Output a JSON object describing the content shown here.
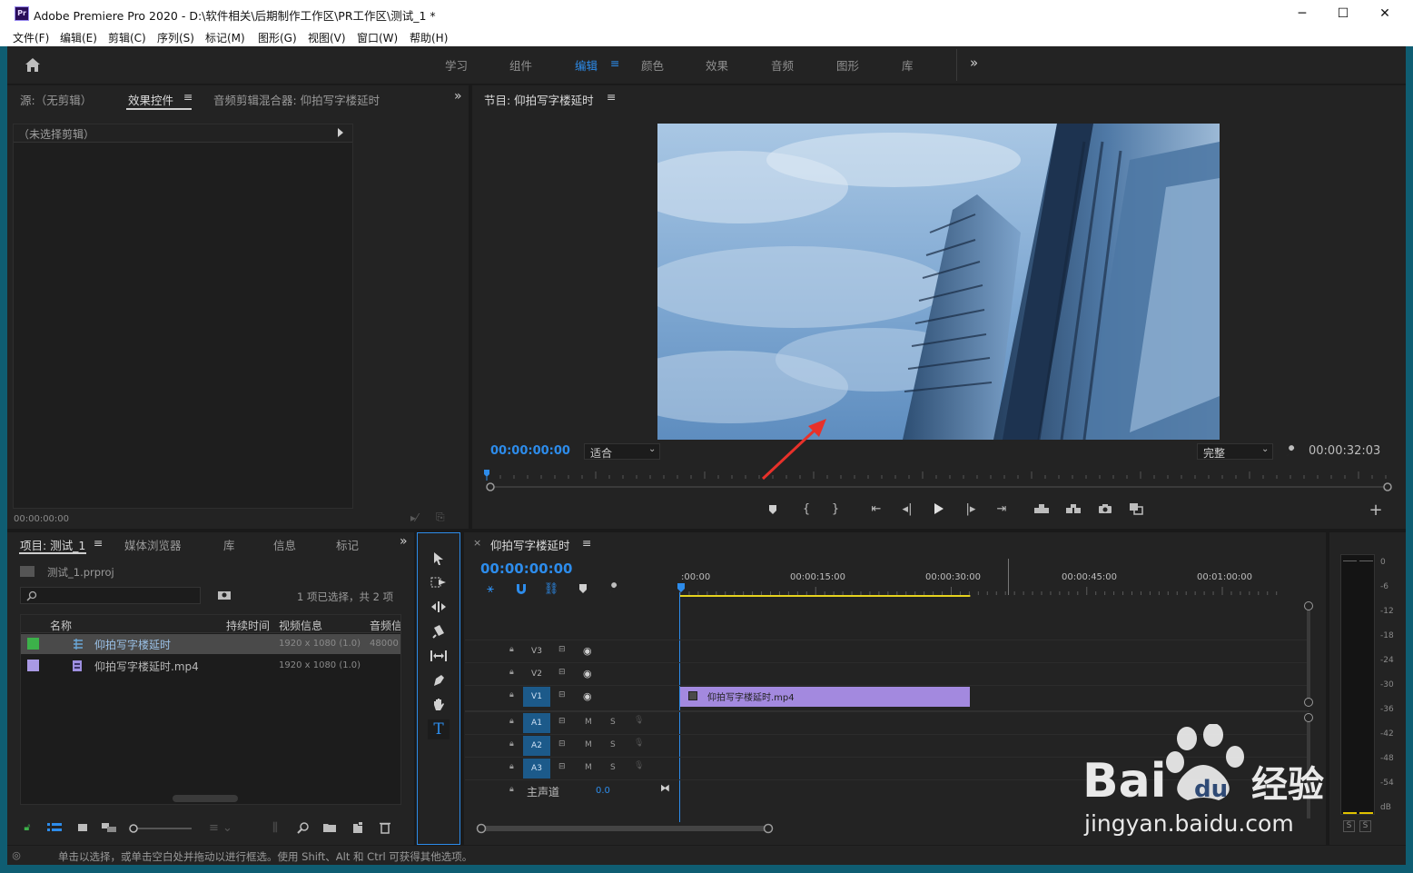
{
  "window": {
    "title": "Adobe Premiere Pro 2020 - D:\\软件相关\\后期制作工作区\\PR工作区\\测试_1 *",
    "app_icon": "Pr",
    "controls": {
      "minimize": "─",
      "maximize": "☐",
      "close": "✕"
    }
  },
  "menu": [
    "文件(F)",
    "编辑(E)",
    "剪辑(C)",
    "序列(S)",
    "标记(M)",
    "图形(G)",
    "视图(V)",
    "窗口(W)",
    "帮助(H)"
  ],
  "workspaces": {
    "tabs": [
      "学习",
      "组件",
      "编辑",
      "颜色",
      "效果",
      "音频",
      "图形",
      "库"
    ],
    "active": "编辑",
    "menu_glyph": "≡",
    "overflow": "»"
  },
  "source_panel": {
    "tabs": [
      "源:（无剪辑）",
      "效果控件",
      "音频剪辑混合器: 仰拍写字楼延时"
    ],
    "active_tab": "效果控件",
    "menu_glyph": "≡",
    "overflow": "»",
    "no_clip": "（未选择剪辑）",
    "timecode": "00:00:00:00"
  },
  "program_monitor": {
    "title": "节目: 仰拍写字楼延时",
    "menu_glyph": "≡",
    "timecode": "00:00:00:00",
    "zoom": "适合",
    "quality": "完整",
    "duration": "00:00:32:03"
  },
  "project_panel": {
    "tabs": [
      "项目: 测试_1",
      "媒体浏览器",
      "库",
      "信息",
      "标记"
    ],
    "active_tab": "项目: 测试_1",
    "menu_glyph": "≡",
    "overflow": "»",
    "file": "测试_1.prproj",
    "selection": "1 项已选择，共 2 项",
    "columns": [
      "名称",
      "持续时间",
      "视频信息",
      "音频信"
    ],
    "rows": [
      {
        "name": "仰拍写字楼延时",
        "video": "1920 x 1080 (1.0)",
        "audio": "48000",
        "color": "#3cb14a"
      },
      {
        "name": "仰拍写字楼延时.mp4",
        "video": "1920 x 1080 (1.0)",
        "audio": "",
        "color": "#a999e4"
      }
    ]
  },
  "timeline": {
    "title": "仰拍写字楼延时",
    "menu_glyph": "≡",
    "close_glyph": "×",
    "timecode": "00:00:00:00",
    "ruler": [
      ":00:00",
      "00:00:15:00",
      "00:00:30:00",
      "00:00:45:00",
      "00:01:00:00"
    ],
    "video_tracks": [
      "V3",
      "V2",
      "V1"
    ],
    "audio_tracks": [
      "A1",
      "A2",
      "A3"
    ],
    "master": "主声道",
    "master_value": "0.0",
    "mute": "M",
    "solo": "S",
    "clip_label": "仰拍写字楼延时.mp4",
    "clip_color": "#a389df",
    "total_seconds": 66,
    "clip_end_seconds": 32.1
  },
  "meter": {
    "scale": [
      "0",
      "-6",
      "-12",
      "-18",
      "-24",
      "-30",
      "-36",
      "-42",
      "-48",
      "-54",
      "dB"
    ],
    "solo_buttons": [
      "S",
      "S"
    ]
  },
  "status_bar": {
    "text": "单击以选择，或单击空白处并拖动以进行框选。使用 Shift、Alt 和 Ctrl 可获得其他选项。"
  },
  "watermark": {
    "logo": "Bai du 经验",
    "url": "jingyan.baidu.com"
  }
}
